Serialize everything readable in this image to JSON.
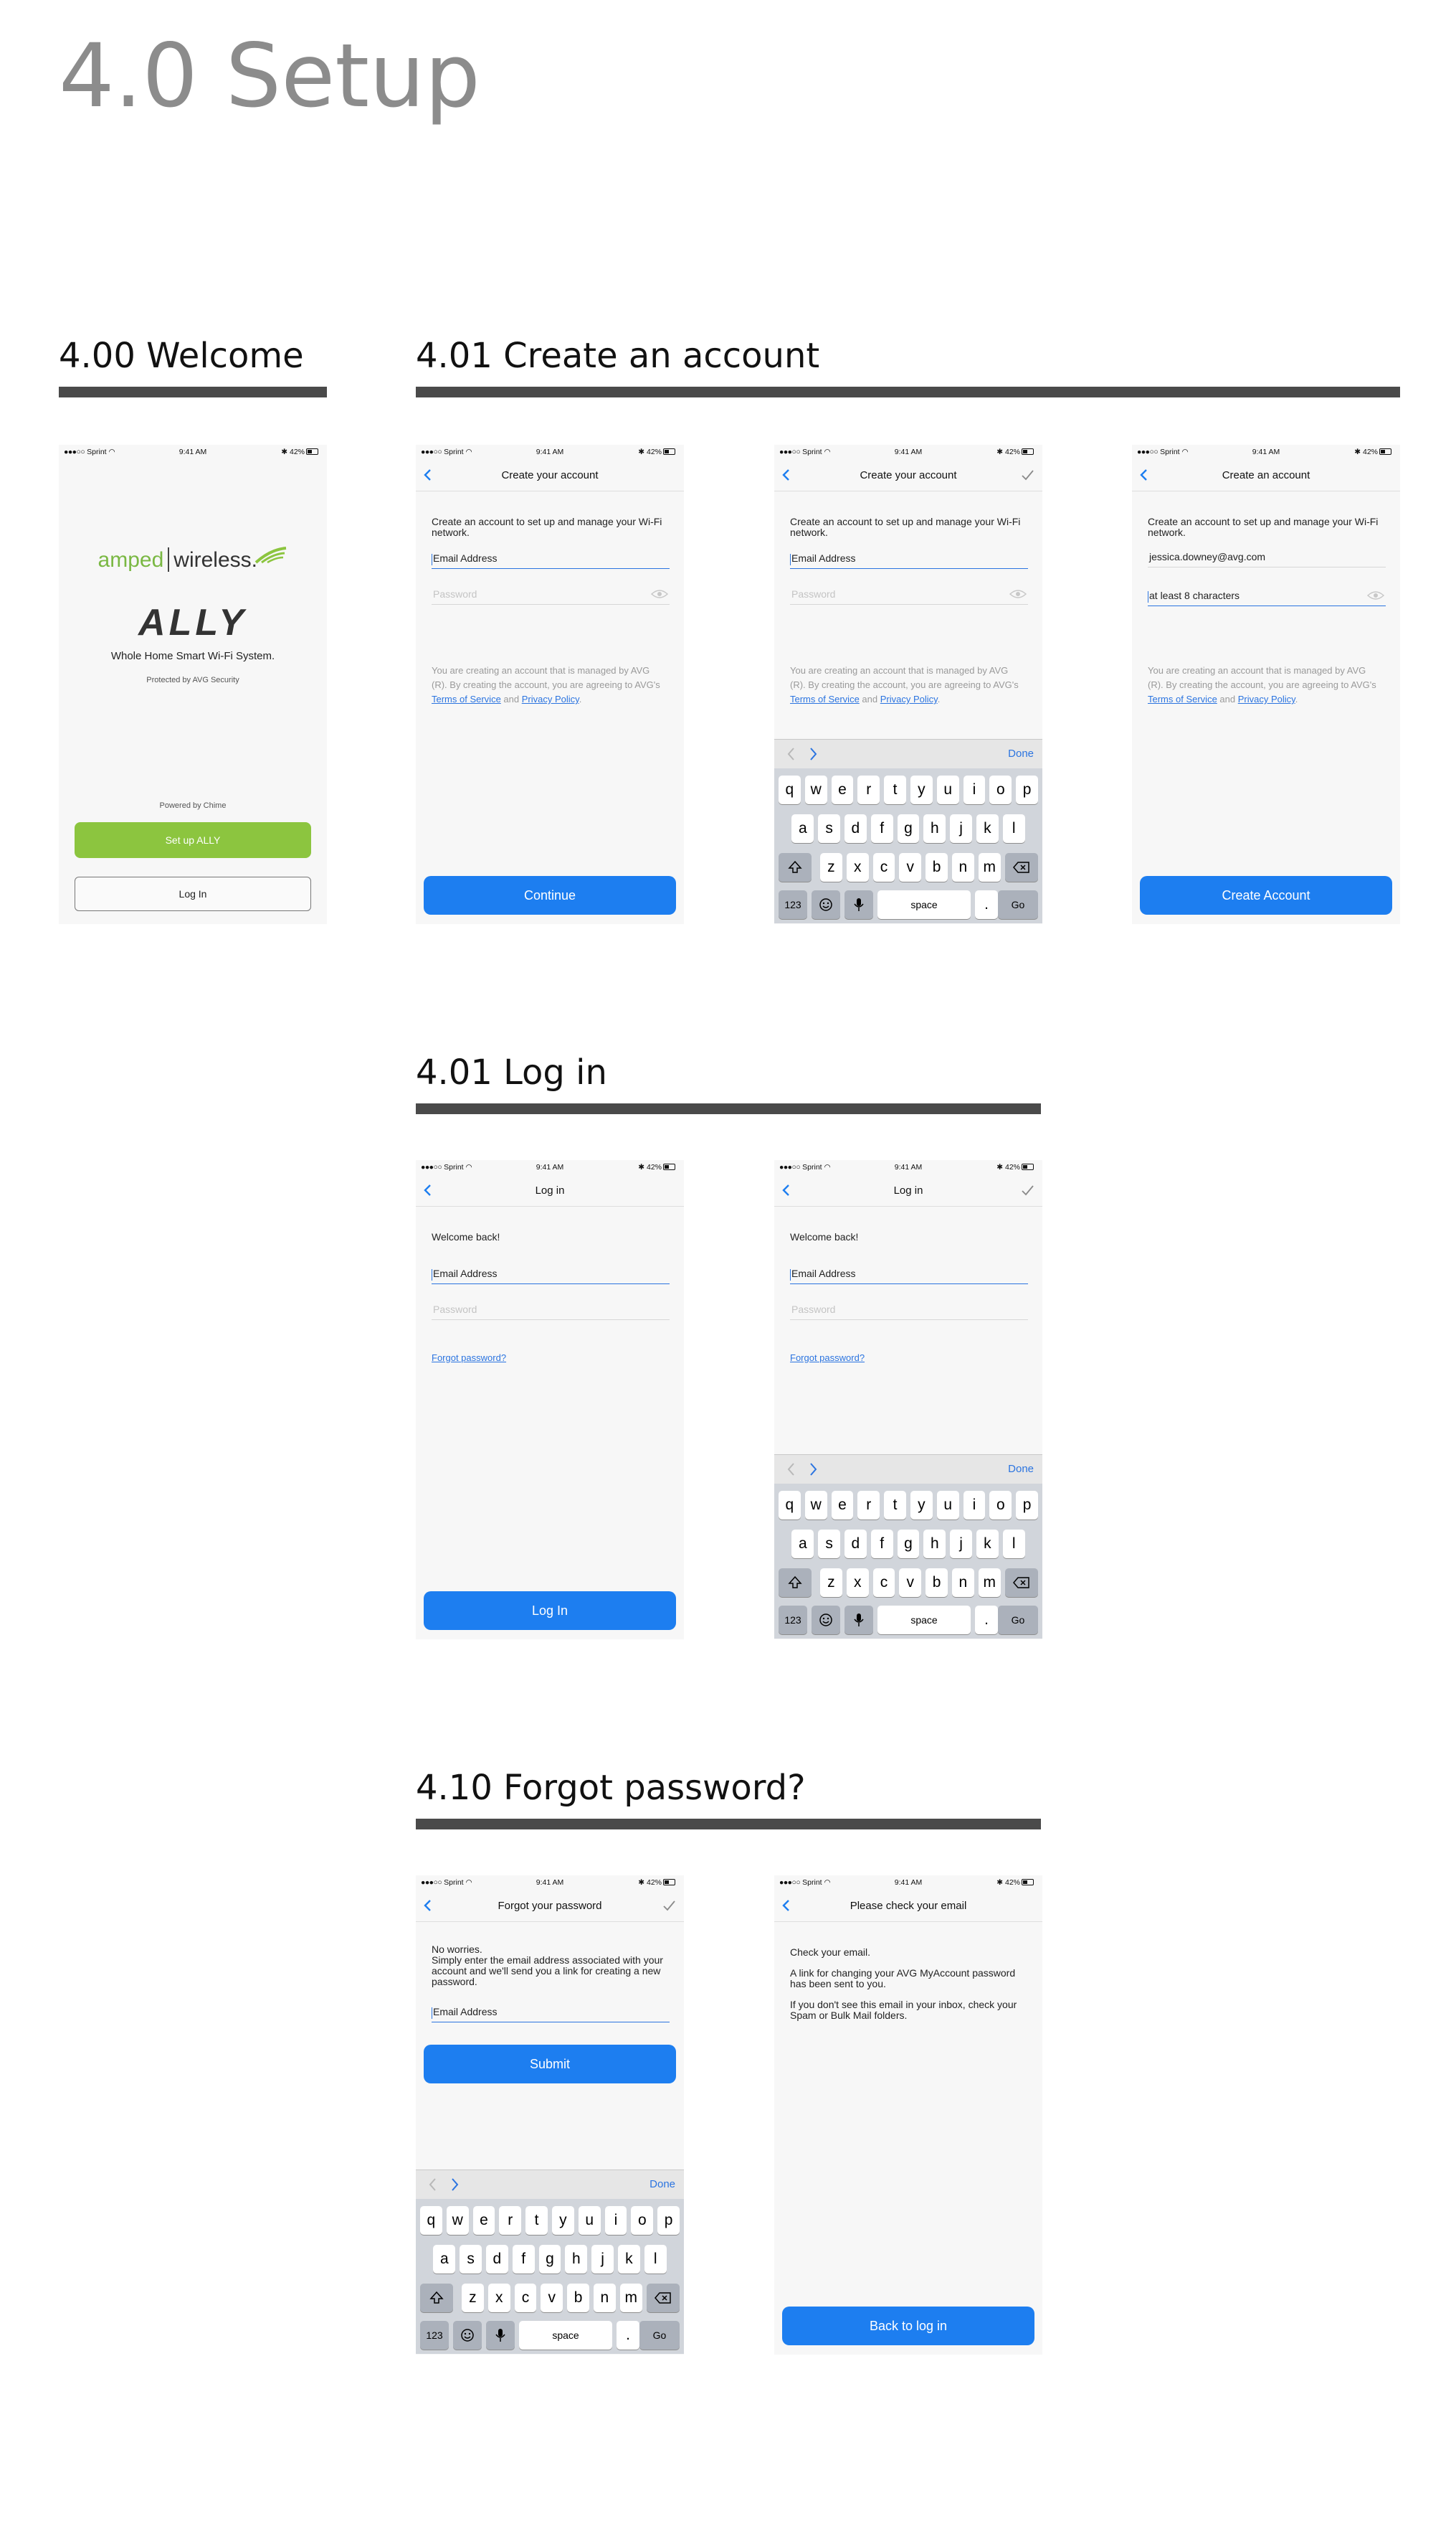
{
  "page": {
    "title": "4.0 Setup"
  },
  "sections": {
    "welcome": "4.00 Welcome",
    "create": "4.01 Create an account",
    "login": "4.01 Log in",
    "forgot": "4.10 Forgot password?"
  },
  "status": {
    "carrier": "Sprint",
    "time": "9:41 AM",
    "battery": "42%"
  },
  "welcome": {
    "brand_amped": "amped",
    "brand_wireless": "wireless.",
    "product": "ALLY",
    "tagline": "Whole Home Smart Wi-Fi System.",
    "protected": "Protected by AVG Security",
    "powered": "Powered by Chime",
    "setup_button": "Set up ALLY",
    "login_button": "Log In"
  },
  "create": {
    "nav_title": "Create your account",
    "nav_title_alt": "Create an account",
    "intro": "Create an account to set up and manage your Wi-Fi network.",
    "email_placeholder": "Email Address",
    "password_placeholder": "Password",
    "email_value": "jessica.downey@avg.com",
    "password_hint": "at least 8 characters",
    "legal_prefix": "You are creating an account that is managed by AVG (R). By creating the account, you are agreeing to AVG's ",
    "terms": "Terms of Service",
    "and": " and ",
    "privacy": "Privacy Policy",
    "period": ".",
    "continue_button": "Continue",
    "create_button": "Create Account"
  },
  "login": {
    "nav_title": "Log in",
    "welcome": "Welcome back!",
    "email_placeholder": "Email Address",
    "password_placeholder": "Password",
    "forgot_link": "Forgot password?",
    "login_button": "Log In"
  },
  "forgot": {
    "nav_title": "Forgot your password",
    "line1": "No worries.",
    "line2": "Simply enter the email address associated with your account and we'll send you a link for creating a new password.",
    "email_placeholder": "Email Address",
    "submit_button": "Submit"
  },
  "check": {
    "nav_title": "Please check your email",
    "line1": "Check your email.",
    "line2": "A link for changing your AVG MyAccount password has been sent to you.",
    "line3": "If you don't see this email in your inbox, check your Spam or Bulk Mail folders.",
    "back_button": "Back to log in"
  },
  "keyboard": {
    "row1": [
      "q",
      "w",
      "e",
      "r",
      "t",
      "y",
      "u",
      "i",
      "o",
      "p"
    ],
    "row2": [
      "a",
      "s",
      "d",
      "f",
      "g",
      "h",
      "j",
      "k",
      "l"
    ],
    "row3": [
      "z",
      "x",
      "c",
      "v",
      "b",
      "n",
      "m"
    ],
    "numbers": "123",
    "space": "space",
    "dot": ".",
    "go": "Go",
    "done": "Done"
  },
  "colors": {
    "primary": "#1d7ef0",
    "green": "#8cc53f",
    "link": "#2b74e0",
    "bar": "#4a4a4a",
    "title_gray": "#8c8c8c"
  }
}
